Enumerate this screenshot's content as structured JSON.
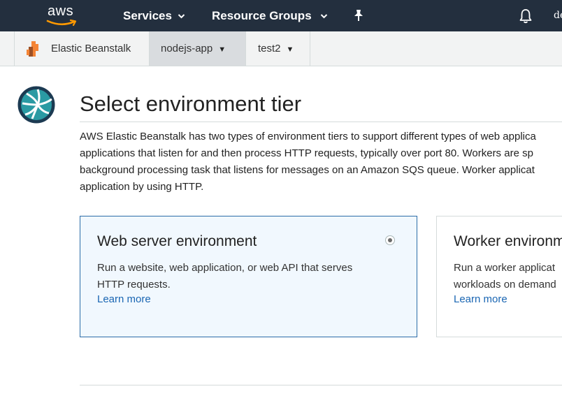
{
  "topnav": {
    "logo_text": "aws",
    "services_label": "Services",
    "resource_groups_label": "Resource Groups",
    "user_label": "de",
    "caret": "⌄"
  },
  "subnav": {
    "app_label": "Elastic Beanstalk",
    "tabs": [
      {
        "label": "nodejs-app"
      },
      {
        "label": "test2"
      }
    ],
    "caret": "▼"
  },
  "main": {
    "title": "Select environment tier",
    "description_lines": [
      "AWS Elastic Beanstalk has two types of environment tiers to support different types of web applica",
      "applications that listen for and then process HTTP requests, typically over port 80. Workers are sp",
      "background processing task that listens for messages on an Amazon SQS queue. Worker applicat",
      "application by using HTTP."
    ],
    "cards": [
      {
        "title": "Web server environment",
        "text_lines": [
          "Run a website, web application, or web API that serves",
          "HTTP requests."
        ],
        "learn_more": "Learn more",
        "selected": true
      },
      {
        "title": "Worker environm",
        "text_lines": [
          "Run a worker applicat",
          "workloads on demand"
        ],
        "learn_more": "Learn more",
        "selected": false
      }
    ]
  },
  "colors": {
    "topnav_bg": "#232f3e",
    "subnav_bg": "#f2f3f3",
    "active_tab_bg": "#d9dcdf",
    "link": "#1a66b3",
    "selected_card_bg": "#f1f8fe",
    "selected_card_border": "#2b6ca8",
    "aws_orange": "#ff9900"
  },
  "icons": [
    "aws-logo",
    "chevron-down-icon",
    "pin-icon",
    "bell-icon",
    "elastic-beanstalk-icon",
    "globe-icon",
    "radio-button"
  ]
}
